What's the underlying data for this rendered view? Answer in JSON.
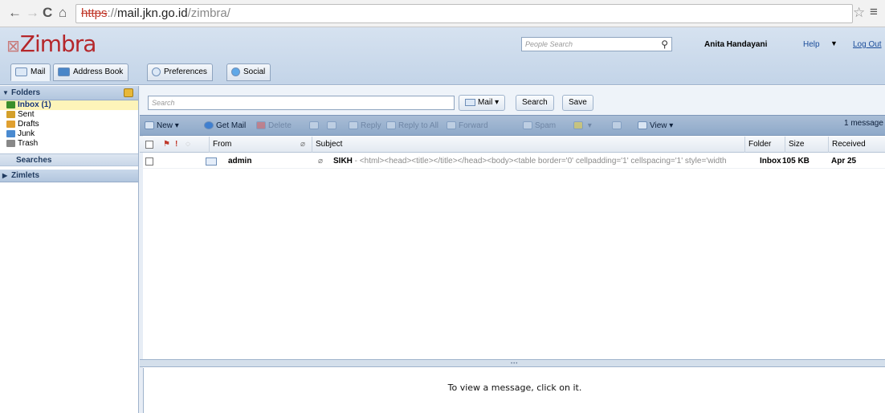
{
  "browser": {
    "back_icon": "←",
    "forward_icon": "→",
    "reload_icon": "C",
    "home_icon": "⌂",
    "url_scheme": "https",
    "url_separator": "://",
    "url_host": "mail.jkn.go.id",
    "url_path": "/zimbra/",
    "star_icon": "☆",
    "menu_icon": "≡"
  },
  "header": {
    "logo": "Zimbra",
    "people_search_placeholder": "People Search",
    "user_name": "Anita Handayani",
    "help": "Help",
    "logout": "Log Out"
  },
  "app_tabs": [
    {
      "label": "Mail",
      "icon": "mail-icon"
    },
    {
      "label": "Address Book",
      "icon": "address-book-icon"
    },
    {
      "label": "Preferences",
      "icon": "preferences-icon"
    },
    {
      "label": "Social",
      "icon": "social-icon"
    }
  ],
  "sidebar": {
    "folders_header": "Folders",
    "folders": [
      {
        "label": "Inbox (1)",
        "selected": true,
        "color": "#3a8f2b"
      },
      {
        "label": "Sent",
        "color": "#d4a02a"
      },
      {
        "label": "Drafts",
        "color": "#e0a030"
      },
      {
        "label": "Junk",
        "color": "#4a8ad0"
      },
      {
        "label": "Trash",
        "color": "#888888"
      }
    ],
    "searches": "Searches",
    "zimlets": "Zimlets"
  },
  "search": {
    "placeholder": "Search",
    "mail_type": "Mail",
    "search_button": "Search",
    "save_button": "Save"
  },
  "toolbar": {
    "new": "New",
    "get_mail": "Get Mail",
    "delete": "Delete",
    "reply": "Reply",
    "reply_all": "Reply to All",
    "forward": "Forward",
    "spam": "Spam",
    "view": "View",
    "message_count": "1 message"
  },
  "list_header": {
    "from": "From",
    "subject": "Subject",
    "folder": "Folder",
    "size": "Size",
    "received": "Received"
  },
  "messages": [
    {
      "from": "admin",
      "subject": "SIKH",
      "fragment": " - <html><head><title></title></head><body><table border='0' cellpadding='1' cellspacing='1' style='width",
      "folder": "Inbox",
      "size": "105 KB",
      "received": "Apr 25"
    }
  ],
  "reading_pane": {
    "message": "To view a message, click on it."
  }
}
